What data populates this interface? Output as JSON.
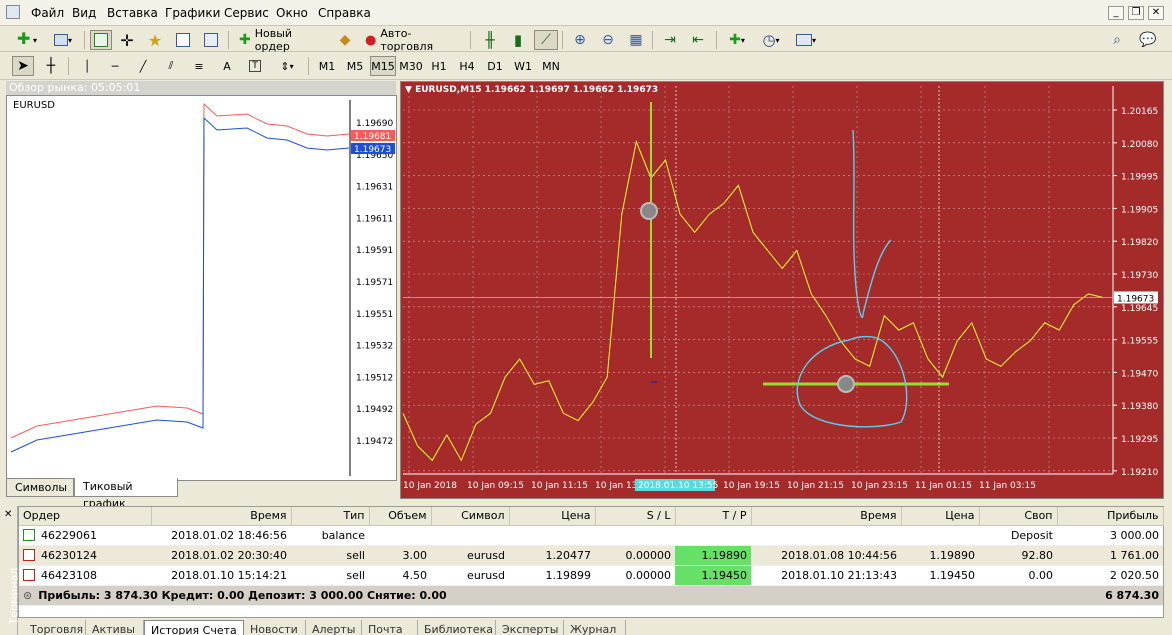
{
  "menu": [
    "Файл",
    "Вид",
    "Вставка",
    "Графики",
    "Сервис",
    "Окно",
    "Справка"
  ],
  "toolbar": {
    "new_order_label": "Новый ордер",
    "auto_trading_label": "Авто-торговля",
    "timeframes": [
      "M1",
      "M5",
      "M15",
      "M30",
      "H1",
      "H4",
      "D1",
      "W1",
      "MN"
    ],
    "active_timeframe": "M15"
  },
  "market_watch": {
    "title": "Обзор рынка: 05:05:01",
    "symbol_label": "EURUSD",
    "tabs": [
      "Символы",
      "Тиковый график"
    ],
    "active_tab": "Тиковый график",
    "price_levels": [
      "1.19690",
      "1.19650",
      "1.19631",
      "1.19611",
      "1.19591",
      "1.19571",
      "1.19551",
      "1.19532",
      "1.19512",
      "1.19492",
      "1.19472"
    ],
    "ask_label": "1.19681",
    "bid_label": "1.19673",
    "ask_color": "#ff5a5a",
    "bid_color": "#1a4fd6"
  },
  "chart": {
    "header": "EURUSD,M15  1.19662 1.19697 1.19662 1.19673",
    "background": "#a52a2a",
    "line_color": "#ffff33",
    "price_levels": [
      "1.20165",
      "1.20080",
      "1.19995",
      "1.19905",
      "1.19820",
      "1.19730",
      "1.19645",
      "1.19555",
      "1.19470",
      "1.19380",
      "1.19295",
      "1.19210"
    ],
    "current_price_label": "1.19673",
    "time_labels": [
      "10 Jan 2018",
      "10 Jan 09:15",
      "10 Jan 11:15",
      "10 Jan 13",
      "10 Jan 17:15",
      "10 Jan 19:15",
      "10 Jan 21:15",
      "10 Jan 23:15",
      "11 Jan 01:15",
      "11 Jan 03:15"
    ],
    "crosshair_time_label": "2018.01.10 13:55",
    "chart_data": {
      "type": "line",
      "series": [
        {
          "name": "EURUSD,M15",
          "values": [
            1.1935,
            1.1926,
            1.1922,
            1.1929,
            1.1922,
            1.1932,
            1.1935,
            1.1945,
            1.195,
            1.1943,
            1.1944,
            1.1935,
            1.1933,
            1.1938,
            1.1945,
            1.199,
            1.201,
            1.2,
            1.2005,
            1.199,
            1.1985,
            1.199,
            1.1993,
            1.1998,
            1.1985,
            1.198,
            1.1975,
            1.198,
            1.1968,
            1.1962,
            1.1955,
            1.195,
            1.1948,
            1.1962,
            1.1958,
            1.196,
            1.195,
            1.1945,
            1.1955,
            1.196,
            1.195,
            1.1948,
            1.1952,
            1.1955,
            1.196,
            1.1958,
            1.1965,
            1.1968,
            1.1967
          ]
        }
      ],
      "ylim": [
        1.1921,
        1.2021
      ]
    }
  },
  "terminal": {
    "side_label": "Терминал",
    "columns": [
      "Ордер",
      "Время",
      "Тип",
      "Объем",
      "Символ",
      "Цена",
      "S / L",
      "T / P",
      "Время",
      "Цена",
      "Своп",
      "Прибыль"
    ],
    "rows": [
      {
        "order": "46229061",
        "time": "2018.01.02 18:46:56",
        "type": "balance",
        "volume": "",
        "symbol": "",
        "price": "",
        "sl": "",
        "tp": "",
        "close_time": "",
        "close_price": "",
        "swap": "Deposit",
        "profit": "3 000.00"
      },
      {
        "order": "46230124",
        "time": "2018.01.02 20:30:40",
        "type": "sell",
        "volume": "3.00",
        "symbol": "eurusd",
        "price": "1.20477",
        "sl": "0.00000",
        "tp": "1.19890",
        "close_time": "2018.01.08 10:44:56",
        "close_price": "1.19890",
        "swap": "92.80",
        "profit": "1 761.00"
      },
      {
        "order": "46423108",
        "time": "2018.01.10 15:14:21",
        "type": "sell",
        "volume": "4.50",
        "symbol": "eurusd",
        "price": "1.19899",
        "sl": "0.00000",
        "tp": "1.19450",
        "close_time": "2018.01.10 21:13:43",
        "close_price": "1.19450",
        "swap": "0.00",
        "profit": "2 020.50"
      }
    ],
    "summary": "Прибыль: 3 874.30  Кредит: 0.00  Депозит: 3 000.00  Снятие: 0.00",
    "summary_total": "6 874.30",
    "tabs": [
      "Торговля",
      "Активы",
      "История Счета",
      "Новости",
      "Алерты",
      "Почта",
      "Библиотека",
      "Эксперты",
      "Журнал"
    ],
    "active_tab": "История Счета"
  }
}
